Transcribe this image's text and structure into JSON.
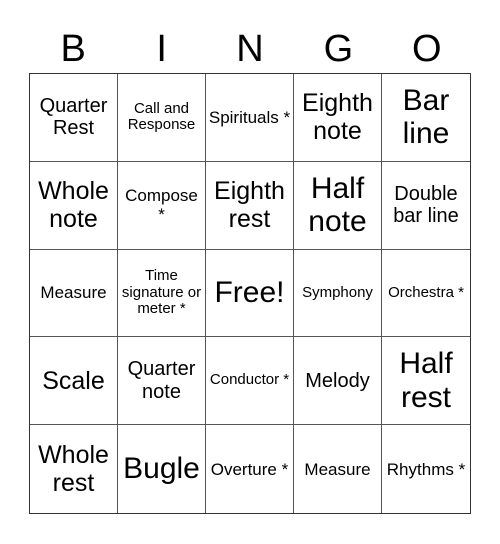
{
  "header": [
    "B",
    "I",
    "N",
    "G",
    "O"
  ],
  "cells": [
    "Quarter Rest",
    "Call and Response",
    "Spirituals *",
    "Eighth note",
    "Bar line",
    "Whole note",
    "Compose *",
    "Eighth rest",
    "Half note",
    "Double bar line",
    "Measure",
    "Time signature or meter *",
    "Free!",
    "Symphony",
    "Orchestra *",
    "Scale",
    "Quarter note",
    "Conductor *",
    "Melody",
    "Half rest",
    "Whole rest",
    "Bugle",
    "Overture *",
    "Measure",
    "Rhythms *"
  ]
}
